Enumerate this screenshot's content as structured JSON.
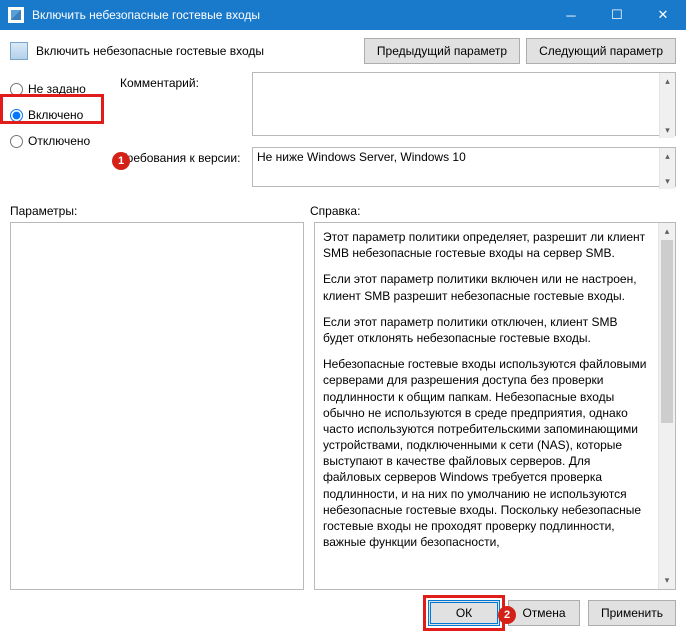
{
  "window": {
    "title": "Включить небезопасные гостевые входы"
  },
  "header": {
    "policy_title": "Включить небезопасные гостевые входы",
    "prev_button": "Предыдущий параметр",
    "next_button": "Следующий параметр"
  },
  "radios": {
    "not_configured": "Не задано",
    "enabled": "Включено",
    "disabled": "Отключено",
    "selected": "enabled"
  },
  "fields": {
    "comment_label": "Комментарий:",
    "comment_value": "",
    "version_label": "Требования к версии:",
    "version_value": "Не ниже Windows Server, Windows 10"
  },
  "sections": {
    "parameters_label": "Параметры:",
    "help_label": "Справка:"
  },
  "help": {
    "p1": "Этот параметр политики определяет, разрешит ли клиент SMB небезопасные гостевые входы на сервер SMB.",
    "p2": "Если этот параметр политики включен или не настроен, клиент SMB разрешит небезопасные гостевые входы.",
    "p3": "Если этот параметр политики отключен, клиент SMB будет отклонять небезопасные гостевые входы.",
    "p4": "Небезопасные гостевые входы используются файловыми серверами для разрешения доступа без проверки подлинности к общим папкам. Небезопасные входы обычно не используются в среде предприятия, однако часто используются потребительскими запоминающими устройствами, подключенными к сети (NAS), которые выступают в качестве файловых серверов. Для файловых серверов Windows требуется проверка подлинности, и на них по умолчанию не используются небезопасные гостевые входы. Поскольку небезопасные гостевые входы не проходят проверку подлинности, важные функции безопасности,"
  },
  "footer": {
    "ok": "ОК",
    "cancel": "Отмена",
    "apply": "Применить"
  },
  "callouts": {
    "one": "1",
    "two": "2"
  }
}
